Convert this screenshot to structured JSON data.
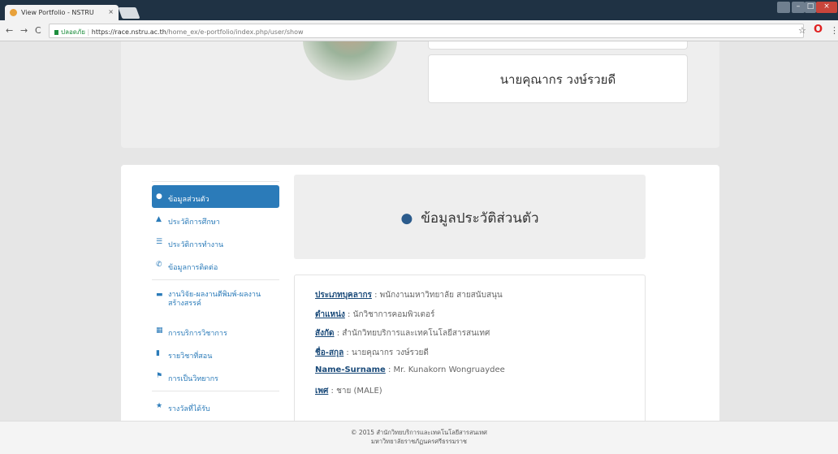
{
  "browser": {
    "tab_title": "View Portfolio - NSTRU",
    "tab_close": "×",
    "secure_label": "ปลอดภัย",
    "url_host": "https://race.nstru.ac.th",
    "url_path": "/home_ex/e-portfolio/index.php/user/show",
    "back": "←",
    "forward": "→",
    "reload": "C",
    "star": "☆",
    "opera": "O",
    "menu": "⋮"
  },
  "profile": {
    "name": "นายคุณากร วงษ์รวยดี"
  },
  "sidebar": {
    "items": [
      {
        "icon": "👤",
        "label": "ข้อมูลส่วนตัว",
        "active": true
      },
      {
        "icon": "🎓",
        "label": "ประวัติการศึกษา"
      },
      {
        "icon": "☰",
        "label": "ประวัติการทำงาน"
      },
      {
        "icon": "✆",
        "label": "ข้อมูลการติดต่อ"
      },
      {
        "icon": "📂",
        "label": "งานวิจัย-ผลงานตีพิมพ์-ผลงานสร้างสรรค์"
      },
      {
        "icon": "⚒",
        "label": "การบริการวิชาการ"
      },
      {
        "icon": "▮",
        "label": "รายวิชาที่สอน"
      },
      {
        "icon": "⚑",
        "label": "การเป็นวิทยากร"
      },
      {
        "icon": "★",
        "label": "รางวัลที่ได้รับ"
      }
    ]
  },
  "header": {
    "icon": "👤",
    "title": "ข้อมูลประวัติส่วนตัว"
  },
  "details": [
    {
      "label": "ประเภทบุคลากร",
      "value": "พนักงานมหาวิทยาลัย สายสนับสนุน"
    },
    {
      "label": "ตำแหน่ง",
      "value": "นักวิชาการคอมพิวเตอร์"
    },
    {
      "label": "สังกัด",
      "value": "สำนักวิทยบริการและเทคโนโลยีสารสนเทศ"
    },
    {
      "label": "ชื่อ-สกุล",
      "value": "นายคุณากร วงษ์รวยดี"
    },
    {
      "label": "Name-Surname",
      "value": "Mr. Kunakorn Wongruaydee"
    },
    {
      "label": "เพศ",
      "value": "ชาย (MALE)"
    }
  ],
  "footer": {
    "line1": "© 2015 สำนักวิทยบริการและเทคโนโลยีสารสนเทศ",
    "line2": "มหาวิทยาลัยราชภัฏนครศรีธรรมราช"
  }
}
